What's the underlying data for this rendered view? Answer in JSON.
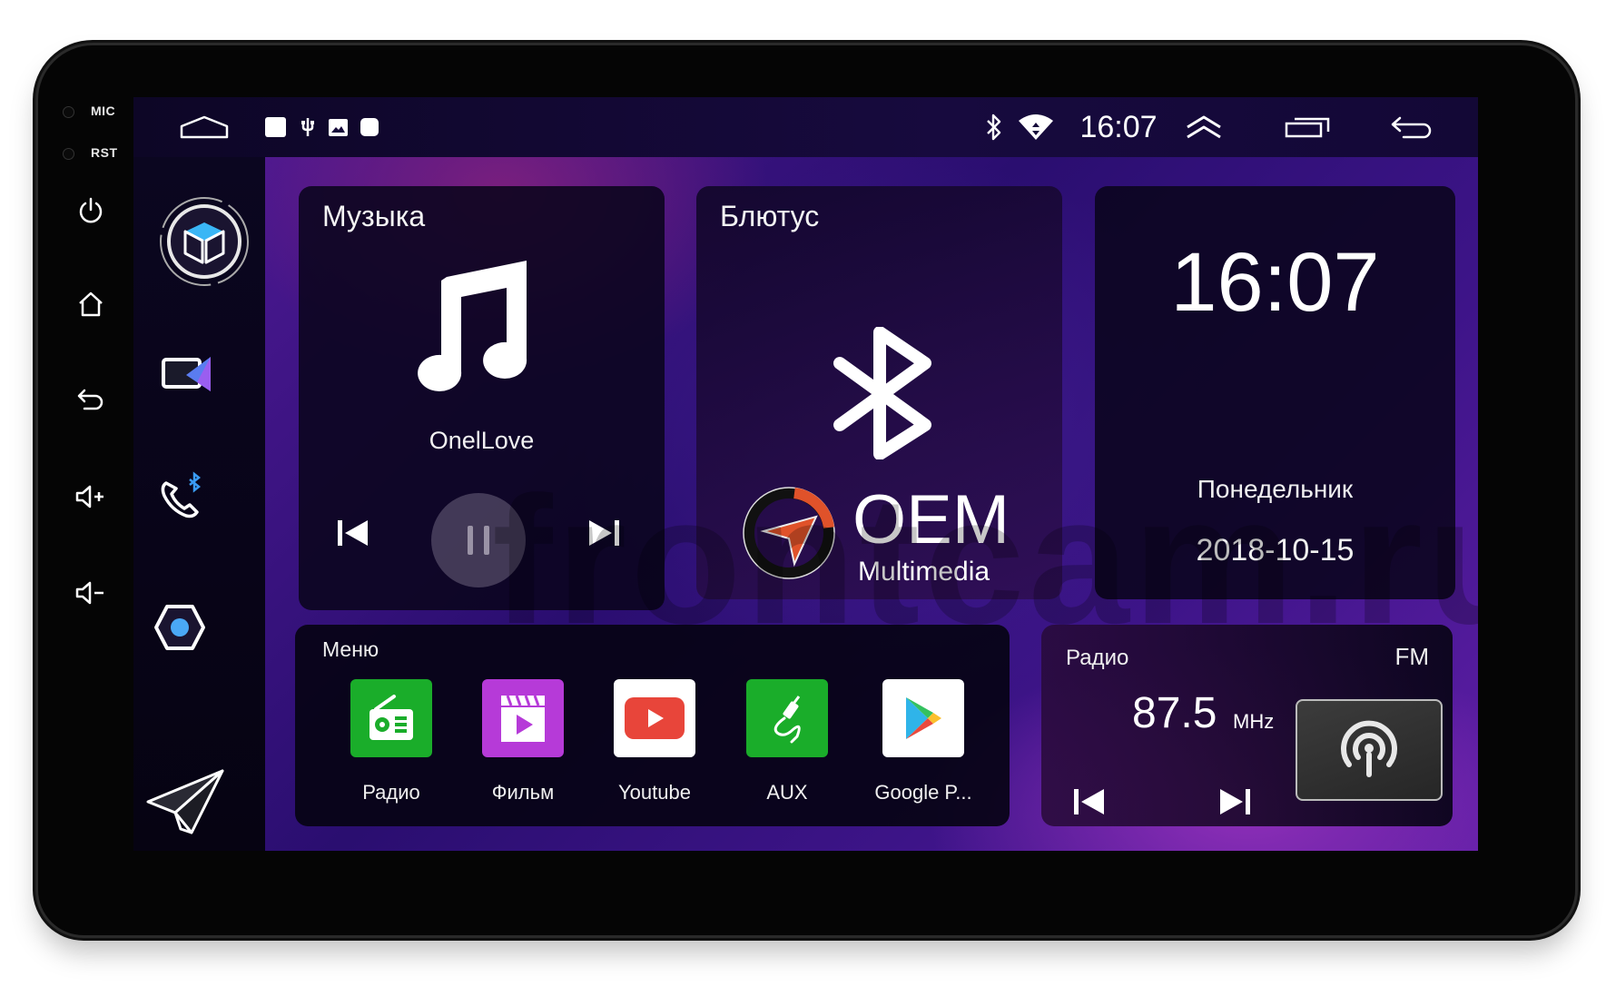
{
  "device": {
    "bezel_labels": {
      "mic": "MIC",
      "rst": "RST"
    },
    "hardware_buttons": [
      {
        "name": "power",
        "icon": "power-icon"
      },
      {
        "name": "home",
        "icon": "home-icon"
      },
      {
        "name": "back",
        "icon": "back-icon"
      },
      {
        "name": "volume-up",
        "icon": "volume-up-icon"
      },
      {
        "name": "volume-down",
        "icon": "volume-down-icon"
      }
    ]
  },
  "statusbar": {
    "left_icons": [
      "home-outline-icon",
      "notification-square-icon",
      "usb-icon",
      "image-icon",
      "notification-dot-icon"
    ],
    "bluetooth_icon": "bluetooth-icon",
    "wifi_icon": "wifi-icon",
    "time": "16:07",
    "right_icons": [
      "expand-up-icon",
      "recent-apps-icon",
      "back-icon"
    ]
  },
  "dock": {
    "items": [
      {
        "name": "3d-launcher",
        "icon": "cube-icon"
      },
      {
        "name": "video",
        "icon": "video-icon"
      },
      {
        "name": "bt-phone",
        "icon": "phone-bluetooth-icon"
      },
      {
        "name": "settings",
        "icon": "hexagon-icon"
      },
      {
        "name": "navigation",
        "icon": "paper-plane-icon"
      }
    ]
  },
  "music": {
    "title": "Музыка",
    "track": "OnelLove",
    "icon": "music-note-icon",
    "state": "playing"
  },
  "bluetooth": {
    "title": "Блютус",
    "icon": "bluetooth-icon",
    "brand_name": "OEM",
    "brand_sub": "Multimedia"
  },
  "clock": {
    "time": "16:07",
    "weekday": "Понедельник",
    "date": "2018-10-15"
  },
  "menu": {
    "title": "Меню",
    "apps": [
      {
        "label": "Радио",
        "icon": "radio-icon",
        "color": "#1aad2a"
      },
      {
        "label": "Фильм",
        "icon": "film-icon",
        "color": "#b63ad8"
      },
      {
        "label": "Youtube",
        "icon": "youtube-icon",
        "color": "#ffffff"
      },
      {
        "label": "AUX",
        "icon": "aux-cable-icon",
        "color": "#1aad2a"
      },
      {
        "label": "Google P...",
        "icon": "google-play-icon",
        "color": "#ffffff"
      }
    ]
  },
  "radio": {
    "title": "Радио",
    "band": "FM",
    "frequency": "87.5",
    "unit": "MHz",
    "icon": "broadcast-icon"
  },
  "watermark": "frontcam.ru",
  "colors": {
    "accent_purple": "#5e1ea6",
    "card_bg": "#0a041c",
    "youtube_red": "#e8453a",
    "app_green": "#1aad2a",
    "app_purple": "#b63ad8",
    "oem_orange": "#e0522a"
  }
}
